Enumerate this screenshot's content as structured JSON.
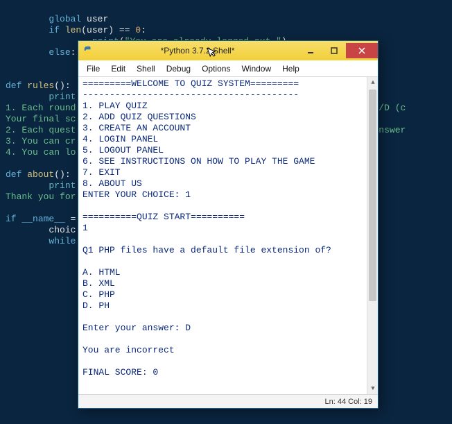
{
  "bg": {
    "line1_global": "global",
    "line1_user": " user",
    "line2_if": "if",
    "line2_len": " len",
    "line2_rest": "(user) == ",
    "line2_zero": "0",
    "line2_colon": ":",
    "line3_print": "print",
    "line3_paren": "(",
    "line3_str": "\"You are already logged out.\"",
    "line3_close": ")",
    "line4_else": "else",
    "line4_colon": ":",
    "line6_def": "def",
    "line6_rules": " rules",
    "line6_sig": "():",
    "line7_print": "print",
    "line8_cm": "1. Each round                                                 s A/B/C/D (c",
    "line9_cm": "Your final sc",
    "line10_cm": "2. Each quest                                                 wrong answer",
    "line11_cm": "3. You can cr",
    "line12_cm": "4. You can lo",
    "line14_def": "def",
    "line14_about": " about",
    "line14_sig": "():",
    "line15_print": "print",
    "line16_cm": "Thank you for",
    "line18_if": "if",
    "line18_name": " __name__ ",
    "line18_eq": "=",
    "line19_choic": "choic",
    "line20_while": "while"
  },
  "window": {
    "title": "*Python 3.7.2 Shell*",
    "menu": [
      "File",
      "Edit",
      "Shell",
      "Debug",
      "Options",
      "Window",
      "Help"
    ],
    "shell_lines": [
      "=========WELCOME TO QUIZ SYSTEM=========",
      "----------------------------------------",
      "1. PLAY QUIZ",
      "2. ADD QUIZ QUESTIONS",
      "3. CREATE AN ACCOUNT",
      "4. LOGIN PANEL",
      "5. LOGOUT PANEL",
      "6. SEE INSTRUCTIONS ON HOW TO PLAY THE GAME",
      "7. EXIT",
      "8. ABOUT US",
      "ENTER YOUR CHOICE: 1",
      "",
      "==========QUIZ START==========",
      "1",
      "",
      "Q1 PHP files have a default file extension of?",
      "",
      "A. HTML",
      "B. XML",
      "C. PHP",
      "D. PH",
      "",
      "Enter your answer: D",
      "",
      "You are incorrect",
      "",
      "FINAL SCORE: 0"
    ],
    "status": "Ln: 44   Col: 19"
  }
}
